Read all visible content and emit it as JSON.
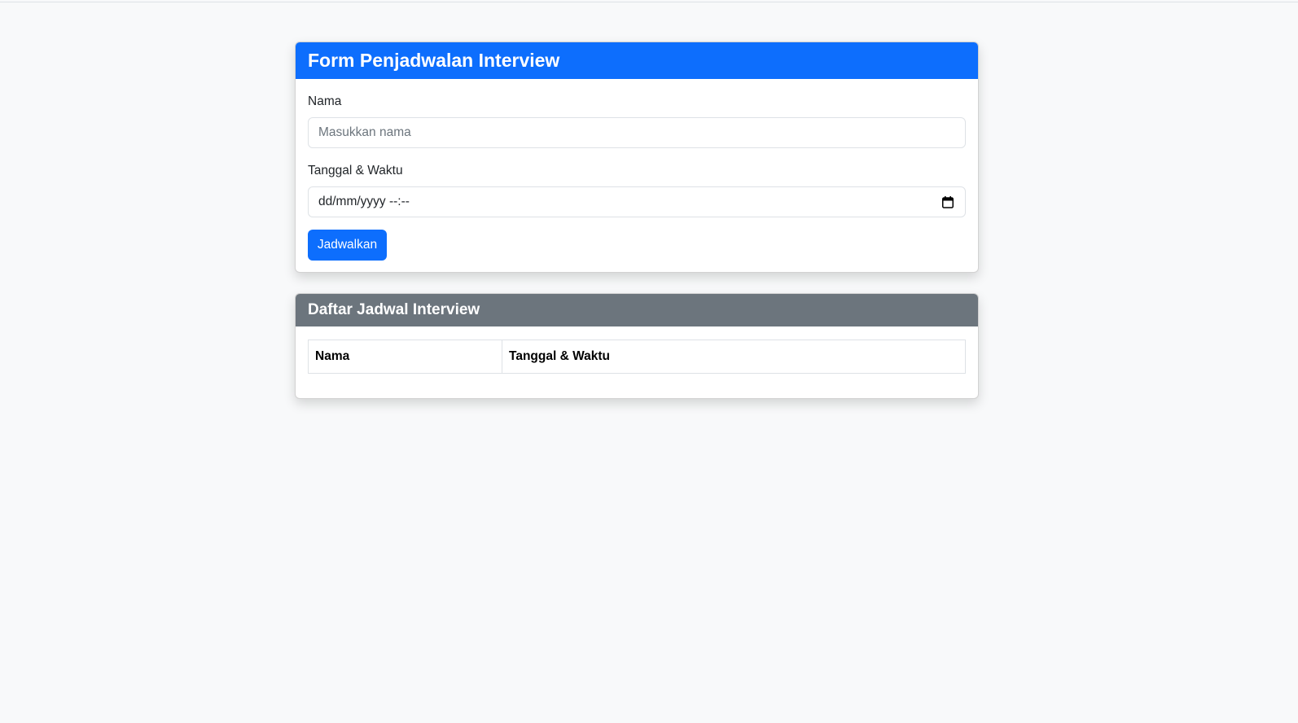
{
  "form_card": {
    "title": "Form Penjadwalan Interview",
    "name_label": "Nama",
    "name_placeholder": "Masukkan nama",
    "datetime_label": "Tanggal & Waktu",
    "datetime_value": "dd/mm/yyyy --:--",
    "calendar_icon": "calendar-icon",
    "submit_label": "Jadwalkan"
  },
  "list_card": {
    "title": "Daftar Jadwal Interview",
    "columns": [
      "Nama",
      "Tanggal & Waktu"
    ],
    "rows": []
  },
  "colors": {
    "primary": "#0d6efd",
    "secondary": "#6c757d",
    "background": "#f8f9fa"
  }
}
